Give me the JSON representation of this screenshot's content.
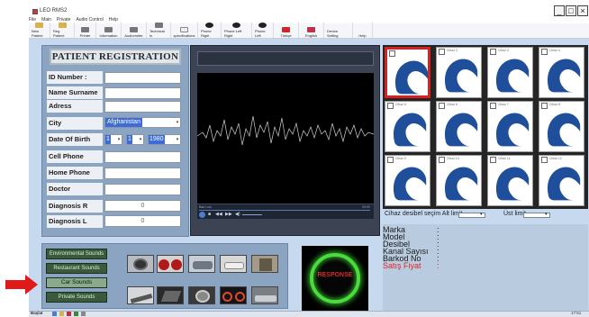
{
  "window": {
    "title": "LEO RMS2",
    "minimize": "_",
    "maximize": "□",
    "close": "×"
  },
  "menu": [
    "File",
    "Main",
    "Private",
    "Audio Control",
    "Help"
  ],
  "toolbar": [
    "New Patient",
    "Reg Patient",
    "Printer",
    "Information",
    "Audiometer",
    "Technical in",
    "specifications",
    "Phone Right",
    "Phone Left Right",
    "Phone Left",
    "Türkçe",
    "English",
    "Device Setting",
    "Help"
  ],
  "patient": {
    "title": "PATIENT REGISTRATION",
    "labels": {
      "id": "ID Number :",
      "name": "Name Surname",
      "address": "Adress",
      "city": "City",
      "dob": "Date Of Birth",
      "cell": "Cell Phone",
      "home": "Home Phone",
      "doctor": "Doctor",
      "diag_r": "Diagnosis R",
      "diag_l": "Diagnosis L"
    },
    "city_value": "Afghanistan",
    "dob_day": "1",
    "dob_month": "1",
    "dob_year": "1980",
    "diag_r_value": "0",
    "diag_l_value": "0"
  },
  "sounds": {
    "environmental": "Environmental Sounds",
    "restaurant": "Restaurant Sounds",
    "car": "Car Sounds",
    "private": "Private Sounds"
  },
  "response_label": "RESPONSE",
  "player": {
    "left_text": "Bad Lulu",
    "right_text": "00:00"
  },
  "hearing_aids": {
    "cells": [
      "",
      "Cihaz 2",
      "Cihaz 3",
      "Cihaz 4",
      "Cihaz 5",
      "Cihaz 6",
      "Cihaz 7",
      "Cihaz 8",
      "Cihaz 9",
      "Cihaz 10",
      "Cihaz 11",
      "Cihaz 12"
    ],
    "selected_index": 0
  },
  "desibel": {
    "label": "Cihaz desibel seçim Alt limit",
    "upper_label": "Üst limit"
  },
  "info": {
    "marka": "Marka",
    "model": "Model",
    "desibel": "Desibel",
    "kanal": "Kanal Sayısı",
    "barkod": "Barkod No",
    "fiyat": "Satış Fiyat",
    "colon": ":",
    "fiyat_color": "#e02424"
  },
  "taskbar": {
    "start": "Başlat",
    "clock": "17:51"
  }
}
